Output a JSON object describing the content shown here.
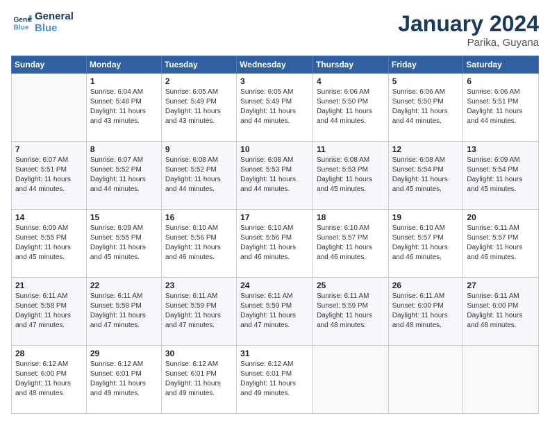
{
  "header": {
    "logo_line1": "General",
    "logo_line2": "Blue",
    "title": "January 2024",
    "subtitle": "Parika, Guyana"
  },
  "calendar": {
    "days_of_week": [
      "Sunday",
      "Monday",
      "Tuesday",
      "Wednesday",
      "Thursday",
      "Friday",
      "Saturday"
    ],
    "weeks": [
      [
        {
          "day": "",
          "info": ""
        },
        {
          "day": "1",
          "info": "Sunrise: 6:04 AM\nSunset: 5:48 PM\nDaylight: 11 hours\nand 43 minutes."
        },
        {
          "day": "2",
          "info": "Sunrise: 6:05 AM\nSunset: 5:49 PM\nDaylight: 11 hours\nand 43 minutes."
        },
        {
          "day": "3",
          "info": "Sunrise: 6:05 AM\nSunset: 5:49 PM\nDaylight: 11 hours\nand 44 minutes."
        },
        {
          "day": "4",
          "info": "Sunrise: 6:06 AM\nSunset: 5:50 PM\nDaylight: 11 hours\nand 44 minutes."
        },
        {
          "day": "5",
          "info": "Sunrise: 6:06 AM\nSunset: 5:50 PM\nDaylight: 11 hours\nand 44 minutes."
        },
        {
          "day": "6",
          "info": "Sunrise: 6:06 AM\nSunset: 5:51 PM\nDaylight: 11 hours\nand 44 minutes."
        }
      ],
      [
        {
          "day": "7",
          "info": "Sunrise: 6:07 AM\nSunset: 5:51 PM\nDaylight: 11 hours\nand 44 minutes."
        },
        {
          "day": "8",
          "info": "Sunrise: 6:07 AM\nSunset: 5:52 PM\nDaylight: 11 hours\nand 44 minutes."
        },
        {
          "day": "9",
          "info": "Sunrise: 6:08 AM\nSunset: 5:52 PM\nDaylight: 11 hours\nand 44 minutes."
        },
        {
          "day": "10",
          "info": "Sunrise: 6:08 AM\nSunset: 5:53 PM\nDaylight: 11 hours\nand 44 minutes."
        },
        {
          "day": "11",
          "info": "Sunrise: 6:08 AM\nSunset: 5:53 PM\nDaylight: 11 hours\nand 45 minutes."
        },
        {
          "day": "12",
          "info": "Sunrise: 6:08 AM\nSunset: 5:54 PM\nDaylight: 11 hours\nand 45 minutes."
        },
        {
          "day": "13",
          "info": "Sunrise: 6:09 AM\nSunset: 5:54 PM\nDaylight: 11 hours\nand 45 minutes."
        }
      ],
      [
        {
          "day": "14",
          "info": "Sunrise: 6:09 AM\nSunset: 5:55 PM\nDaylight: 11 hours\nand 45 minutes."
        },
        {
          "day": "15",
          "info": "Sunrise: 6:09 AM\nSunset: 5:55 PM\nDaylight: 11 hours\nand 45 minutes."
        },
        {
          "day": "16",
          "info": "Sunrise: 6:10 AM\nSunset: 5:56 PM\nDaylight: 11 hours\nand 46 minutes."
        },
        {
          "day": "17",
          "info": "Sunrise: 6:10 AM\nSunset: 5:56 PM\nDaylight: 11 hours\nand 46 minutes."
        },
        {
          "day": "18",
          "info": "Sunrise: 6:10 AM\nSunset: 5:57 PM\nDaylight: 11 hours\nand 46 minutes."
        },
        {
          "day": "19",
          "info": "Sunrise: 6:10 AM\nSunset: 5:57 PM\nDaylight: 11 hours\nand 46 minutes."
        },
        {
          "day": "20",
          "info": "Sunrise: 6:11 AM\nSunset: 5:57 PM\nDaylight: 11 hours\nand 46 minutes."
        }
      ],
      [
        {
          "day": "21",
          "info": "Sunrise: 6:11 AM\nSunset: 5:58 PM\nDaylight: 11 hours\nand 47 minutes."
        },
        {
          "day": "22",
          "info": "Sunrise: 6:11 AM\nSunset: 5:58 PM\nDaylight: 11 hours\nand 47 minutes."
        },
        {
          "day": "23",
          "info": "Sunrise: 6:11 AM\nSunset: 5:59 PM\nDaylight: 11 hours\nand 47 minutes."
        },
        {
          "day": "24",
          "info": "Sunrise: 6:11 AM\nSunset: 5:59 PM\nDaylight: 11 hours\nand 47 minutes."
        },
        {
          "day": "25",
          "info": "Sunrise: 6:11 AM\nSunset: 5:59 PM\nDaylight: 11 hours\nand 48 minutes."
        },
        {
          "day": "26",
          "info": "Sunrise: 6:11 AM\nSunset: 6:00 PM\nDaylight: 11 hours\nand 48 minutes."
        },
        {
          "day": "27",
          "info": "Sunrise: 6:11 AM\nSunset: 6:00 PM\nDaylight: 11 hours\nand 48 minutes."
        }
      ],
      [
        {
          "day": "28",
          "info": "Sunrise: 6:12 AM\nSunset: 6:00 PM\nDaylight: 11 hours\nand 48 minutes."
        },
        {
          "day": "29",
          "info": "Sunrise: 6:12 AM\nSunset: 6:01 PM\nDaylight: 11 hours\nand 49 minutes."
        },
        {
          "day": "30",
          "info": "Sunrise: 6:12 AM\nSunset: 6:01 PM\nDaylight: 11 hours\nand 49 minutes."
        },
        {
          "day": "31",
          "info": "Sunrise: 6:12 AM\nSunset: 6:01 PM\nDaylight: 11 hours\nand 49 minutes."
        },
        {
          "day": "",
          "info": ""
        },
        {
          "day": "",
          "info": ""
        },
        {
          "day": "",
          "info": ""
        }
      ]
    ]
  }
}
